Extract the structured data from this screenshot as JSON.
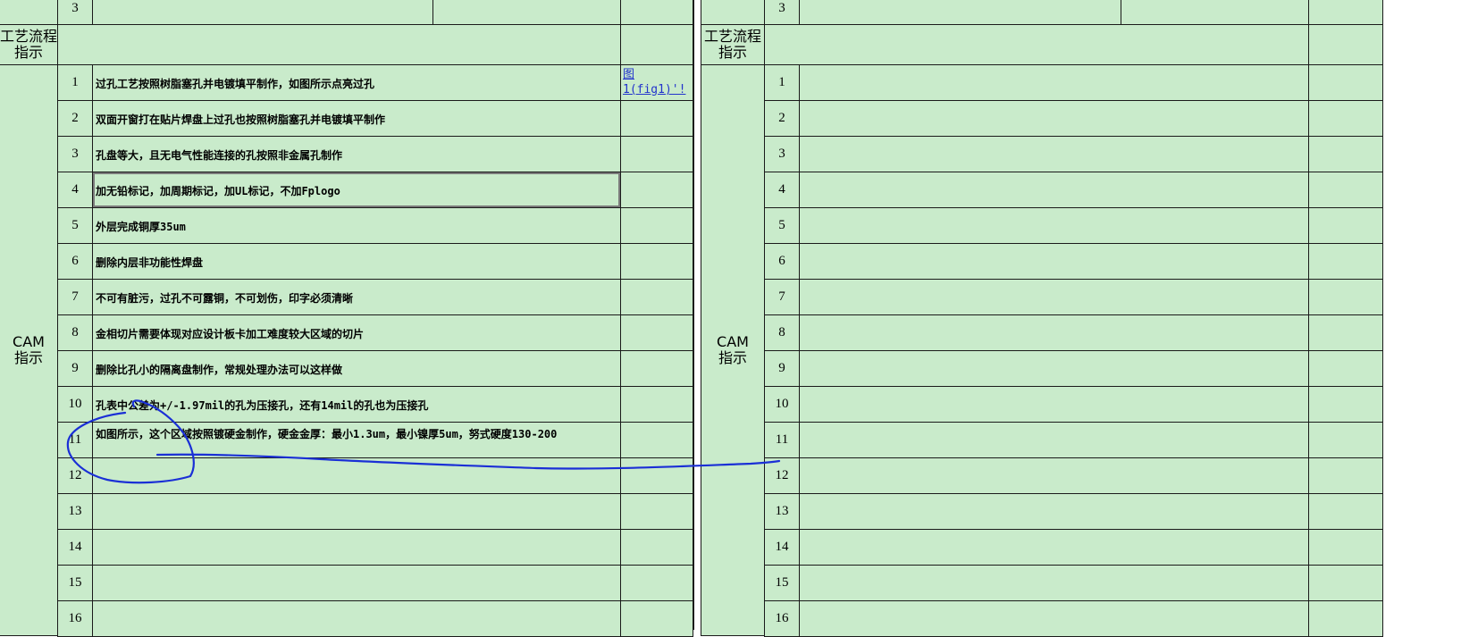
{
  "process_label": "工艺流程\n指示",
  "cam_label": "CAM\n指示",
  "top_row_num": "3",
  "left_rows": [
    {
      "num": "1",
      "text": "过孔工艺按照树脂塞孔并电镀填平制作，如图所示点亮过孔",
      "note": "图\n1(fig1)'!"
    },
    {
      "num": "2",
      "text": "双面开窗打在贴片焊盘上过孔也按照树脂塞孔并电镀填平制作",
      "note": ""
    },
    {
      "num": "3",
      "text": "孔盘等大，且无电气性能连接的孔按照非金属孔制作",
      "note": ""
    },
    {
      "num": "4",
      "text": "加无铅标记，加周期标记，加UL标记，不加Fplogo",
      "note": ""
    },
    {
      "num": "5",
      "text": "外层完成铜厚35um",
      "note": ""
    },
    {
      "num": "6",
      "text": "删除内层非功能性焊盘",
      "note": ""
    },
    {
      "num": "7",
      "text": "不可有脏污，过孔不可露铜，不可划伤，印字必须清晰",
      "note": ""
    },
    {
      "num": "8",
      "text": "金相切片需要体现对应设计板卡加工难度较大区域的切片",
      "note": ""
    },
    {
      "num": "9",
      "text": "删除比孔小的隔离盘制作，常规处理办法可以这样做",
      "note": ""
    },
    {
      "num": "10",
      "text": "孔表中公差为+/-1.97mil的孔为压接孔，还有14mil的孔也为压接孔",
      "note": ""
    },
    {
      "num": "11",
      "text": "如图所示，这个区域按照镀硬金制作，硬金金厚：最小1.3um，最小镍厚5um，努式硬度130-200",
      "note": ""
    },
    {
      "num": "12",
      "text": "",
      "note": ""
    },
    {
      "num": "13",
      "text": "",
      "note": ""
    },
    {
      "num": "14",
      "text": "",
      "note": ""
    },
    {
      "num": "15",
      "text": "",
      "note": ""
    },
    {
      "num": "16",
      "text": "",
      "note": ""
    }
  ],
  "right_rows": [
    "1",
    "2",
    "3",
    "4",
    "5",
    "6",
    "7",
    "8",
    "9",
    "10",
    "11",
    "12",
    "13",
    "14",
    "15",
    "16"
  ],
  "colors": {
    "cell_bg": "#c9ebcb",
    "grid": "#1a1a1a",
    "ink": "#1a2fd6",
    "link": "#2233cc"
  }
}
